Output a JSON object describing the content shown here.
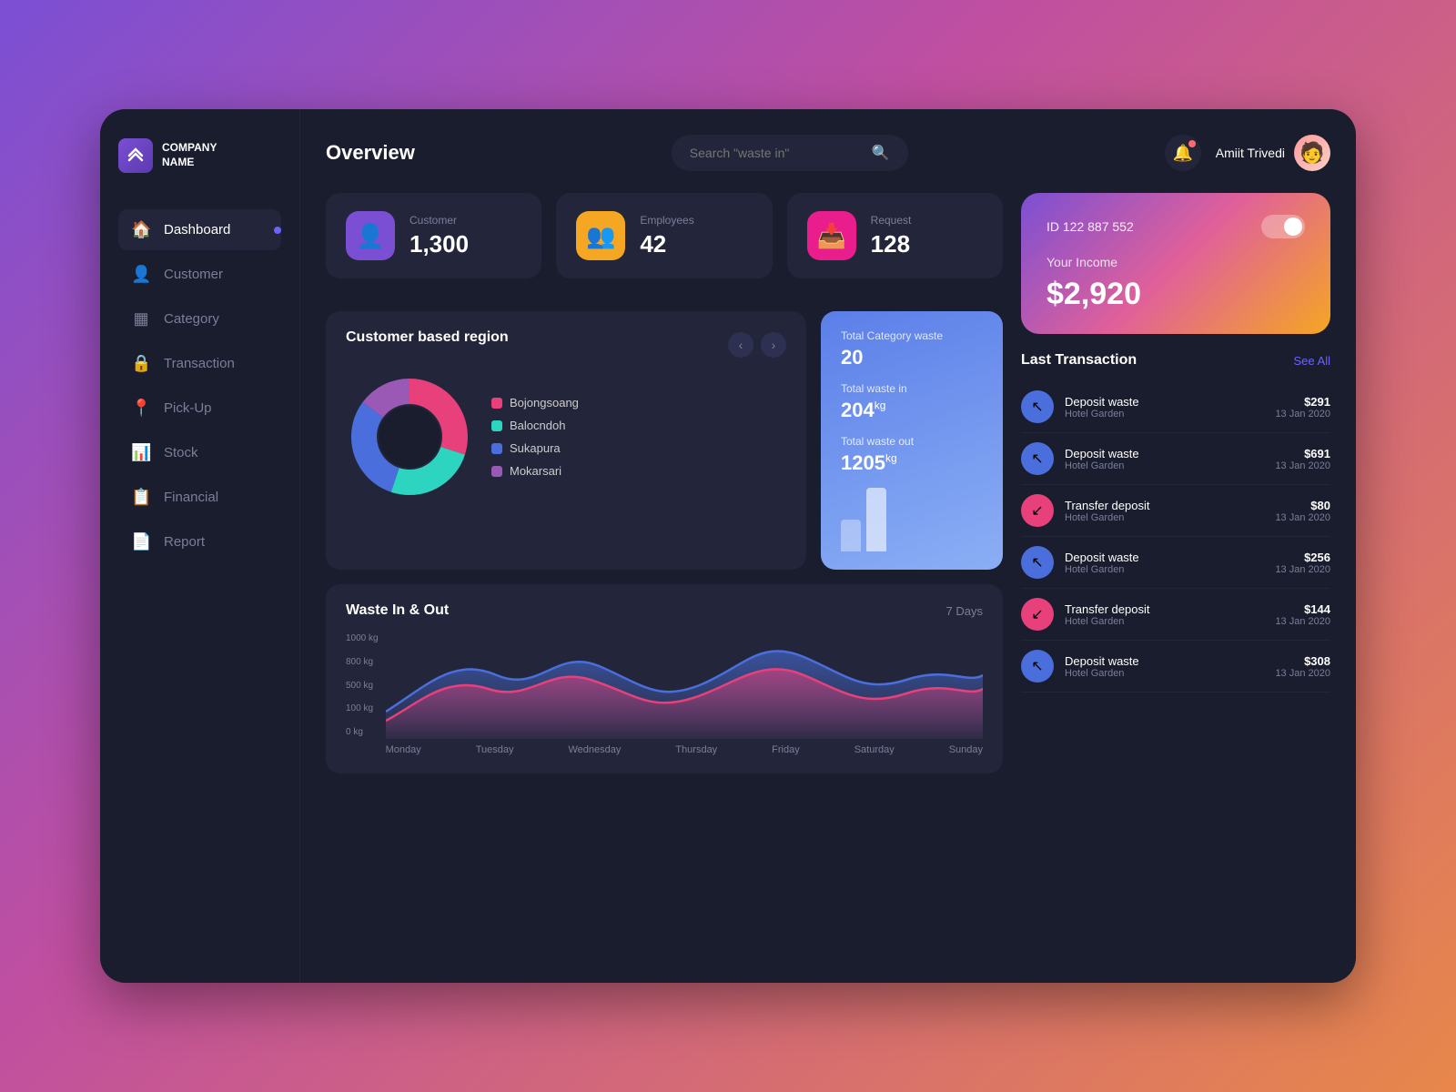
{
  "app": {
    "title": "Overview",
    "company": {
      "name": "COMPANY\nNAME"
    },
    "search": {
      "placeholder": "Search \"waste in\""
    },
    "user": {
      "name": "Amiit Trivedi"
    },
    "notification_badge": true
  },
  "sidebar": {
    "items": [
      {
        "id": "dashboard",
        "label": "Dashboard",
        "icon": "🏠",
        "active": true
      },
      {
        "id": "customer",
        "label": "Customer",
        "icon": "👤",
        "active": false
      },
      {
        "id": "category",
        "label": "Category",
        "icon": "▦",
        "active": false
      },
      {
        "id": "transaction",
        "label": "Transaction",
        "icon": "🔒",
        "active": false
      },
      {
        "id": "pickup",
        "label": "Pick-Up",
        "icon": "📍",
        "active": false
      },
      {
        "id": "stock",
        "label": "Stock",
        "icon": "📊",
        "active": false
      },
      {
        "id": "financial",
        "label": "Financial",
        "icon": "📋",
        "active": false
      },
      {
        "id": "report",
        "label": "Report",
        "icon": "📄",
        "active": false
      }
    ]
  },
  "stats": [
    {
      "id": "customer",
      "label": "Customer",
      "value": "1,300",
      "icon": "👤",
      "color": "purple"
    },
    {
      "id": "employees",
      "label": "Employees",
      "value": "42",
      "icon": "👥",
      "color": "orange"
    },
    {
      "id": "request",
      "label": "Request",
      "value": "128",
      "icon": "📥",
      "color": "pink"
    }
  ],
  "income_card": {
    "id_label": "ID 122 887 552",
    "income_label": "Your Income",
    "amount": "$2,920"
  },
  "customer_region": {
    "title": "Customer based region",
    "legend": [
      {
        "label": "Bojongsoang",
        "color": "#e8407a"
      },
      {
        "label": "Balocndoh",
        "color": "#2dd4bf"
      },
      {
        "label": "Sukapura",
        "color": "#4a6fdc"
      },
      {
        "label": "Mokarsari",
        "color": "#9b59b6"
      }
    ],
    "donut": {
      "segments": [
        {
          "color": "#e8407a",
          "pct": 30
        },
        {
          "color": "#2dd4bf",
          "pct": 25
        },
        {
          "color": "#4a6fdc",
          "pct": 30
        },
        {
          "color": "#9b59b6",
          "pct": 15
        }
      ]
    }
  },
  "waste_stats": {
    "total_category_label": "Total Category waste",
    "total_category_value": "20",
    "total_in_label": "Total waste in",
    "total_in_value": "204",
    "total_in_unit": "kg",
    "total_out_label": "Total waste out",
    "total_out_value": "1205",
    "total_out_unit": "kg"
  },
  "waste_chart": {
    "title": "Waste In & Out",
    "period": "7 Days",
    "y_labels": [
      "1000 kg",
      "800 kg",
      "500 kg",
      "100 kg",
      "0 kg"
    ],
    "x_labels": [
      "Monday",
      "Tuesday",
      "Wednesday",
      "Thursday",
      "Friday",
      "Saturday",
      "Sunday"
    ]
  },
  "last_transaction": {
    "title": "Last Transaction",
    "see_all_label": "See All",
    "items": [
      {
        "type": "deposit",
        "name": "Deposit waste",
        "sub": "Hotel Garden",
        "amount": "$291",
        "date": "13 Jan 2020",
        "color": "blue",
        "dir": "up"
      },
      {
        "type": "deposit",
        "name": "Deposit waste",
        "sub": "Hotel Garden",
        "amount": "$691",
        "date": "13 Jan 2020",
        "color": "blue",
        "dir": "up"
      },
      {
        "type": "transfer",
        "name": "Transfer deposit",
        "sub": "Hotel Garden",
        "amount": "$80",
        "date": "13 Jan 2020",
        "color": "pink",
        "dir": "down"
      },
      {
        "type": "deposit",
        "name": "Deposit waste",
        "sub": "Hotel Garden",
        "amount": "$256",
        "date": "13 Jan 2020",
        "color": "blue",
        "dir": "up"
      },
      {
        "type": "transfer",
        "name": "Transfer deposit",
        "sub": "Hotel Garden",
        "amount": "$144",
        "date": "13 Jan 2020",
        "color": "pink",
        "dir": "down"
      },
      {
        "type": "deposit",
        "name": "Deposit waste",
        "sub": "Hotel Garden",
        "amount": "$308",
        "date": "13 Jan 2020",
        "color": "blue",
        "dir": "up"
      }
    ]
  }
}
